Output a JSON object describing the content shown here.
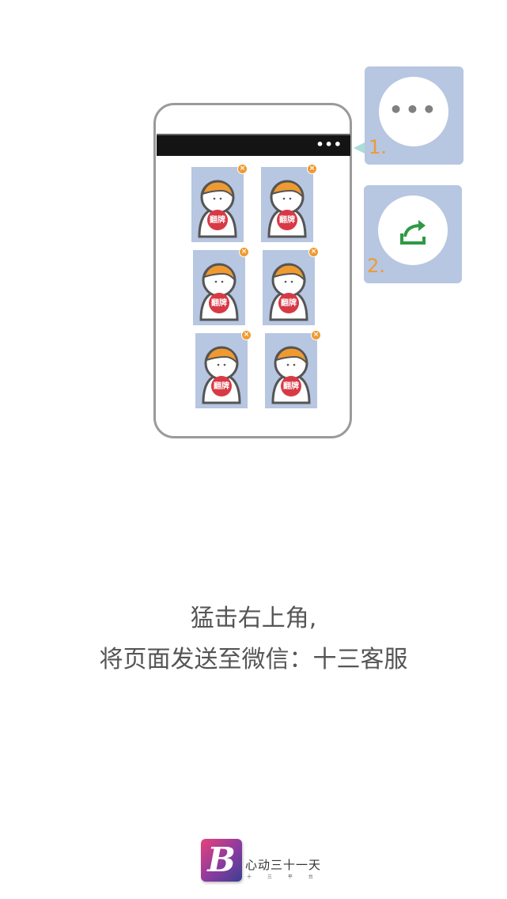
{
  "colors": {
    "card_bg": "#b7c6e1",
    "accent_orange": "#ef9a30",
    "badge_red": "#d83a45",
    "share_green": "#2f9a45",
    "phone_bar": "#141414",
    "text_gray": "#555555"
  },
  "phone": {
    "menu_dots": "•••",
    "cards": [
      {
        "label": "翻牌",
        "close": "×"
      },
      {
        "label": "翻牌",
        "close": "×"
      },
      {
        "label": "翻牌",
        "close": "×"
      },
      {
        "label": "翻牌",
        "close": "×"
      },
      {
        "label": "翻牌",
        "close": "×"
      },
      {
        "label": "翻牌",
        "close": "×"
      }
    ]
  },
  "steps": [
    {
      "number": "1.",
      "icon": "more-dots-icon",
      "glyph": "•••"
    },
    {
      "number": "2.",
      "icon": "share-icon"
    }
  ],
  "instruction": {
    "line1": "猛击右上角,",
    "line2": "将页面发送至微信：十三客服"
  },
  "brand": {
    "logo_letter": "B",
    "name": "心动三十一天",
    "subtitle": "十 三 平 台"
  }
}
